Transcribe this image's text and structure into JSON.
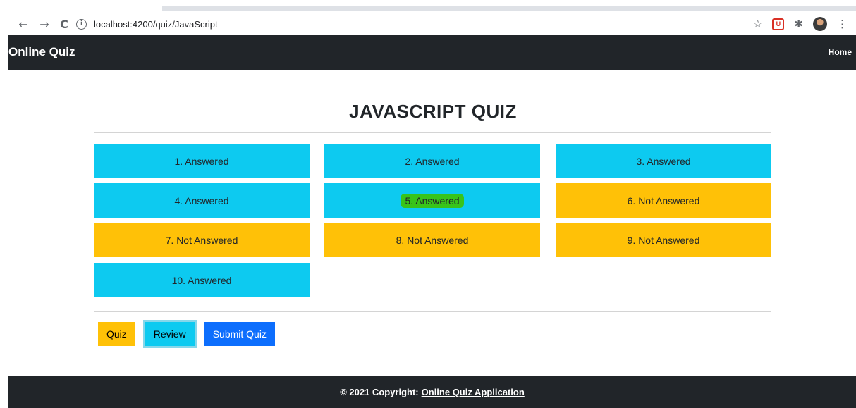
{
  "browser": {
    "url": "localhost:4200/quiz/JavaScript",
    "back_glyph": "←",
    "forward_glyph": "→",
    "reload_glyph": "C",
    "info_glyph": "i",
    "star_glyph": "☆",
    "ext_glyph": "U",
    "puzzle_glyph": "✱",
    "menu_glyph": "⋮",
    "icons": [
      "back-icon",
      "forward-icon",
      "reload-icon",
      "info-icon",
      "star-icon",
      "extension-icon",
      "puzzle-icon",
      "avatar",
      "menu-icon"
    ]
  },
  "navbar": {
    "brand": "Online Quiz",
    "home": "Home"
  },
  "page": {
    "title": "JAVASCRIPT QUIZ"
  },
  "questions": [
    {
      "label": "1. Answered",
      "status": "answered"
    },
    {
      "label": "2. Answered",
      "status": "answered"
    },
    {
      "label": "3. Answered",
      "status": "answered"
    },
    {
      "label": "4. Answered",
      "status": "answered"
    },
    {
      "label": "5. Answered",
      "status": "answered"
    },
    {
      "label": "6. Not Answered",
      "status": "not-answered"
    },
    {
      "label": "7. Not Answered",
      "status": "not-answered"
    },
    {
      "label": "8. Not Answered",
      "status": "not-answered"
    },
    {
      "label": "9. Not Answered",
      "status": "not-answered"
    },
    {
      "label": "10. Answered",
      "status": "answered"
    }
  ],
  "buttons": {
    "quiz": "Quiz",
    "review": "Review",
    "submit": "Submit Quiz"
  },
  "footer": {
    "prefix": "© 2021 Copyright:",
    "link": "Online Quiz Application"
  },
  "colors": {
    "answered": "#0dcaf0",
    "not_answered": "#ffc107",
    "primary": "#0d6efd",
    "dark": "#212529",
    "highlight": "#38c41a"
  }
}
